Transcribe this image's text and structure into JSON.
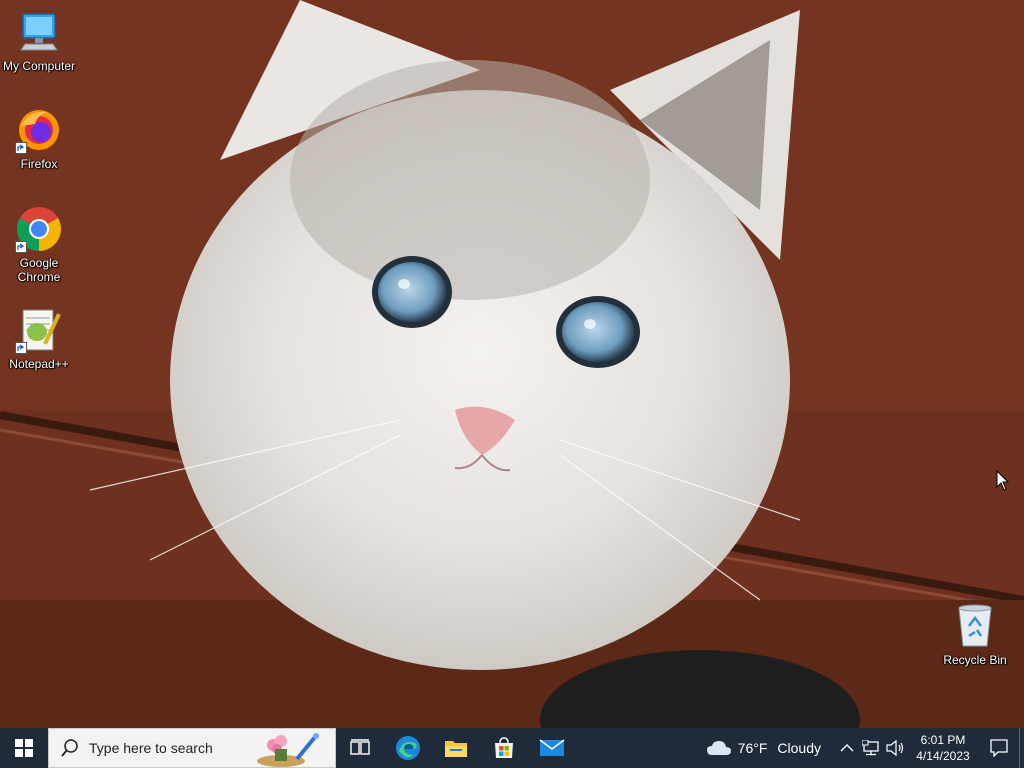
{
  "desktop": {
    "icons": [
      {
        "label": "My Computer",
        "icon": "computer-icon"
      },
      {
        "label": "Firefox",
        "icon": "firefox-icon"
      },
      {
        "label": "Google Chrome",
        "icon": "chrome-icon"
      },
      {
        "label": "Notepad++",
        "icon": "notepadpp-icon"
      },
      {
        "label": "Recycle Bin",
        "icon": "recycle-bin-icon"
      }
    ]
  },
  "taskbar": {
    "start_icon": "windows-logo-icon",
    "search_placeholder": "Type here to search",
    "pinned": [
      "task-view-icon",
      "edge-icon",
      "file-explorer-icon",
      "store-icon",
      "mail-icon"
    ],
    "weather": {
      "temp": "76°F",
      "condition": "Cloudy",
      "icon": "cloud-icon"
    },
    "tray_icons": [
      "chevron-up-icon",
      "network-icon",
      "volume-icon"
    ],
    "clock": {
      "time": "6:01 PM",
      "date": "4/14/2023"
    },
    "notification_icon": "notification-icon"
  },
  "colors": {
    "taskbar_bg": "#1f2a3a",
    "search_bg": "#f3f3f3",
    "wallpaper_wood": "#6a2e1d"
  }
}
